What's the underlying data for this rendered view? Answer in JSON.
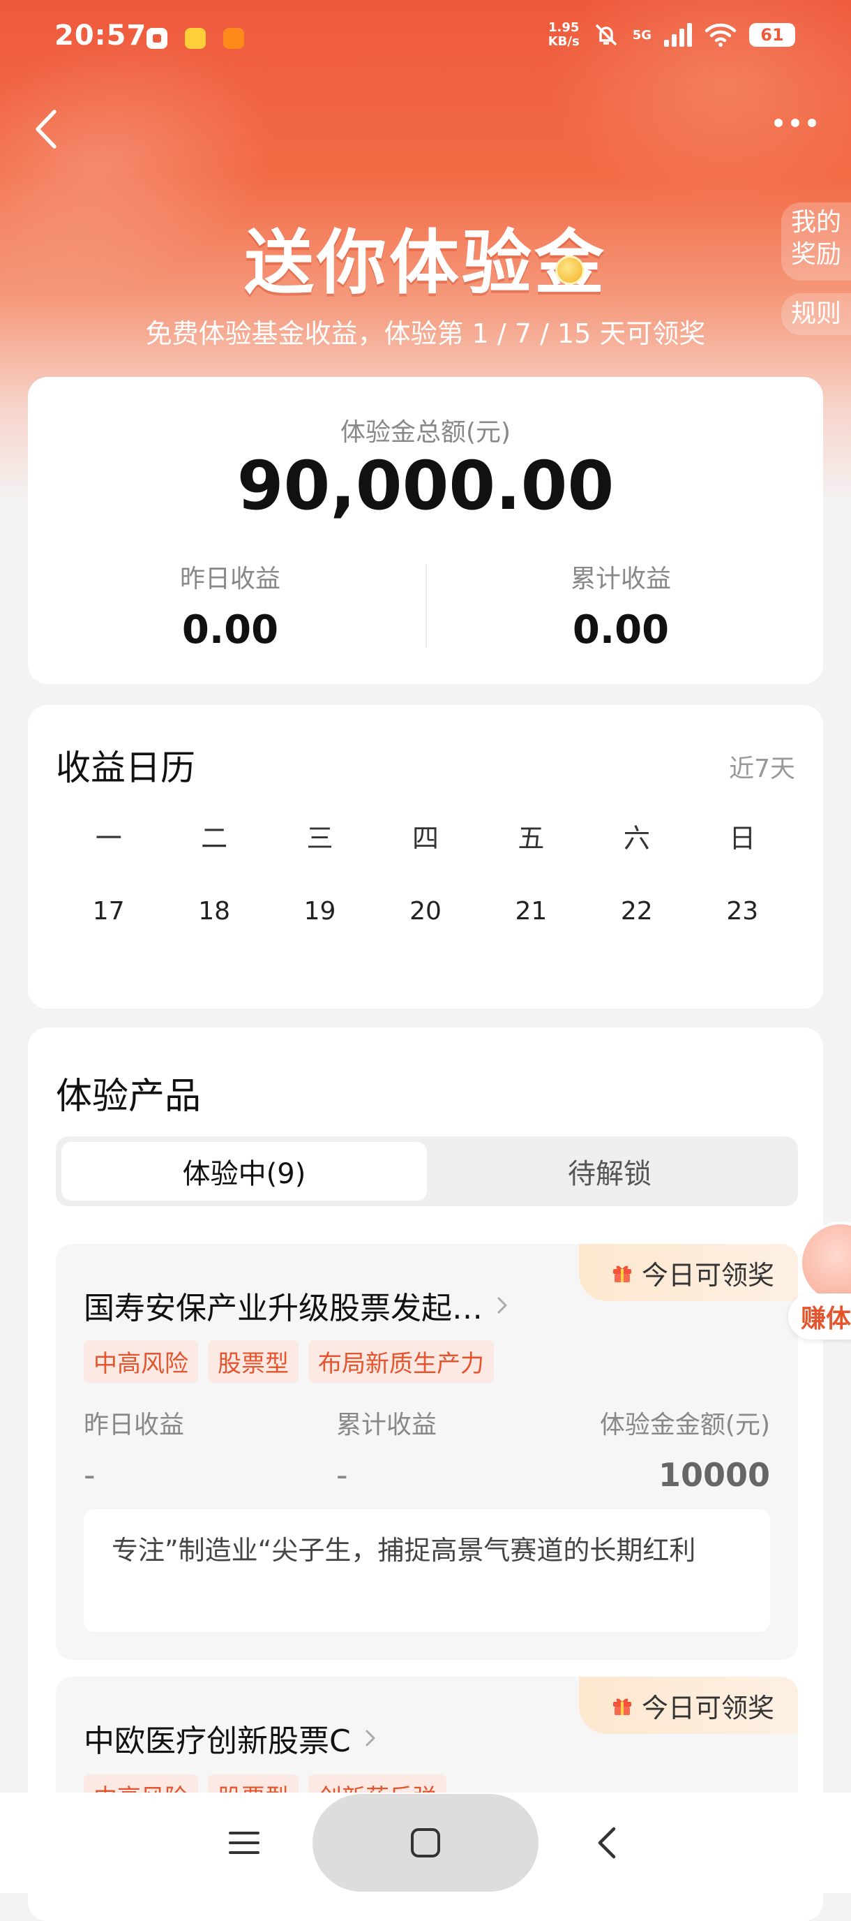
{
  "status_bar": {
    "time": "20:57",
    "net_speed_value": "1.95",
    "net_speed_unit": "KB/s",
    "network": "5G",
    "battery": "61"
  },
  "header": {
    "back_icon": "chevron-left-icon",
    "more_icon": "more-horizontal-icon"
  },
  "hero": {
    "title": "送你体验金",
    "subtitle": "免费体验基金收益，体验第 1 / 7 / 15 天可领奖",
    "side_rewards": "我的奖励",
    "side_rules": "规则"
  },
  "summary": {
    "total_label": "体验金总额(元)",
    "total_value": "90,000.00",
    "yesterday_label": "昨日收益",
    "yesterday_value": "0.00",
    "cumulative_label": "累计收益",
    "cumulative_value": "0.00"
  },
  "calendar": {
    "title": "收益日历",
    "range": "近7天",
    "weekdays": [
      "一",
      "二",
      "三",
      "四",
      "五",
      "六",
      "日"
    ],
    "dates": [
      "17",
      "18",
      "19",
      "20",
      "21",
      "22",
      "23"
    ]
  },
  "products": {
    "title": "体验产品",
    "tabs": [
      {
        "label": "体验中(9)",
        "active": true
      },
      {
        "label": "待解锁",
        "active": false
      }
    ],
    "items": [
      {
        "badge": "今日可领奖",
        "name": "国寿安保产业升级股票发起…",
        "tags": [
          "中高风险",
          "股票型",
          "布局新质生产力"
        ],
        "yesterday_label": "昨日收益",
        "yesterday_value": "-",
        "cumulative_label": "累计收益",
        "cumulative_value": "-",
        "amount_label": "体验金金额(元)",
        "amount_value": "10000",
        "description": "专注”制造业“尖子生，捕捉高景气赛道的长期红利"
      },
      {
        "badge": "今日可领奖",
        "name": "中欧医疗创新股票C",
        "tags": [
          "中高风险",
          "股票型",
          "创新药反弹"
        ]
      }
    ]
  },
  "floating": {
    "label": "赚体"
  },
  "navbar": {
    "menu_icon": "menu-icon",
    "home_icon": "home-square-icon",
    "back_icon": "back-triangle-icon"
  },
  "colors": {
    "brand": "#ee5a3c",
    "tag_text": "#e4552d",
    "tag_bg": "#fde9e4",
    "badge_bg": "#fde8cf"
  }
}
